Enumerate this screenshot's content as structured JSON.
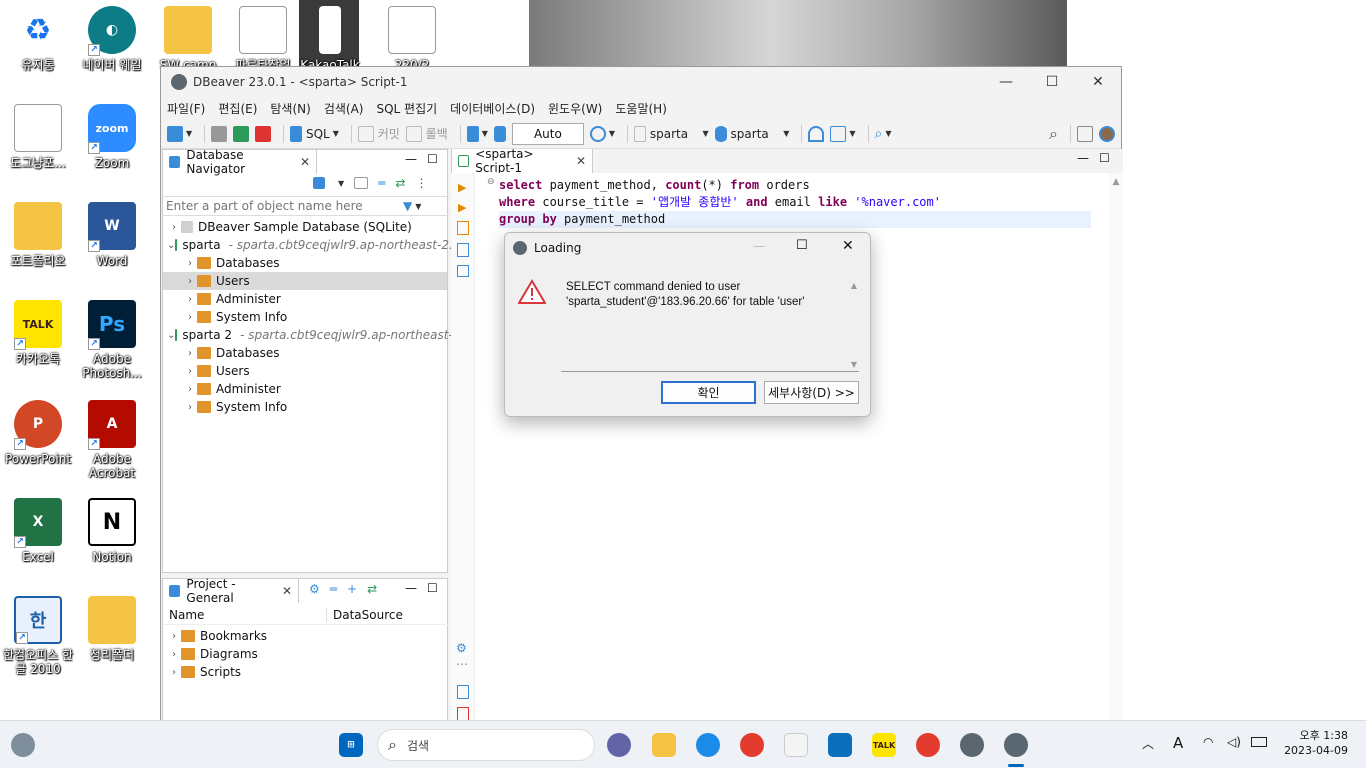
{
  "desktop": {
    "top_labels": [
      "휴지통",
      "네이버 웨일",
      "SW camp",
      "파르타창업",
      "KakaoTalk",
      "220/2"
    ],
    "icons": [
      {
        "label": "유지통",
        "name": "recycle-bin-icon"
      },
      {
        "label": "네이버 웨일",
        "name": "whale-browser-icon"
      },
      {
        "label": "도그냥포...",
        "name": "document-icon"
      },
      {
        "label": "Zoom",
        "name": "zoom-icon"
      },
      {
        "label": "포트폴리오",
        "name": "folder-icon"
      },
      {
        "label": "Word",
        "name": "word-icon"
      },
      {
        "label": "카카오톡",
        "name": "kakaotalk-icon"
      },
      {
        "label": "Adobe Photosh...",
        "name": "photoshop-icon"
      },
      {
        "label": "PowerPoint",
        "name": "powerpoint-icon"
      },
      {
        "label": "Adobe Acrobat",
        "name": "acrobat-icon"
      },
      {
        "label": "Excel",
        "name": "excel-icon"
      },
      {
        "label": "Notion",
        "name": "notion-icon"
      },
      {
        "label": "한컴오피스 한글 2010",
        "name": "hwp-icon"
      },
      {
        "label": "정리폴더",
        "name": "folder-icon"
      }
    ]
  },
  "window": {
    "title": "DBeaver 23.0.1 - <sparta> Script-1",
    "menu": [
      "파일(F)",
      "편집(E)",
      "탐색(N)",
      "검색(A)",
      "SQL 편집기",
      "데이터베이스(D)",
      "윈도우(W)",
      "도움말(H)"
    ],
    "toolbar": {
      "sql": "SQL",
      "commit": "커밋",
      "rollback": "롤백",
      "auto": "Auto",
      "datasource": "sparta",
      "schema": "sparta"
    }
  },
  "navigator": {
    "tab": "Database Navigator",
    "filter_placeholder": "Enter a part of object name here",
    "tree": [
      {
        "label": "DBeaver Sample Database (SQLite)",
        "level": 0,
        "sub": ""
      },
      {
        "label": "sparta",
        "level": 0,
        "sub": "- sparta.cbt9ceqjwlr9.ap-northeast-2.r"
      },
      {
        "label": "Databases",
        "level": 1,
        "sub": ""
      },
      {
        "label": "Users",
        "level": 1,
        "sub": "",
        "selected": true
      },
      {
        "label": "Administer",
        "level": 1,
        "sub": ""
      },
      {
        "label": "System Info",
        "level": 1,
        "sub": ""
      },
      {
        "label": "sparta 2",
        "level": 0,
        "sub": "- sparta.cbt9ceqjwlr9.ap-northeast-2"
      },
      {
        "label": "Databases",
        "level": 1,
        "sub": ""
      },
      {
        "label": "Users",
        "level": 1,
        "sub": ""
      },
      {
        "label": "Administer",
        "level": 1,
        "sub": ""
      },
      {
        "label": "System Info",
        "level": 1,
        "sub": ""
      }
    ]
  },
  "project": {
    "tab": "Project - General",
    "col_name": "Name",
    "col_datasource": "DataSource",
    "items": [
      "Bookmarks",
      "Diagrams",
      "Scripts"
    ]
  },
  "editor": {
    "tab": "<sparta> Script-1",
    "lines": [
      [
        {
          "t": "select",
          "c": "kw"
        },
        {
          "t": " payment_method, ",
          "c": ""
        },
        {
          "t": "count",
          "c": "kw"
        },
        {
          "t": "(*) ",
          "c": ""
        },
        {
          "t": "from",
          "c": "kw"
        },
        {
          "t": " orders",
          "c": ""
        }
      ],
      [
        {
          "t": "where",
          "c": "kw"
        },
        {
          "t": " course_title = ",
          "c": ""
        },
        {
          "t": "'앱개발 종합반'",
          "c": "str"
        },
        {
          "t": " ",
          "c": ""
        },
        {
          "t": "and",
          "c": "kw"
        },
        {
          "t": " email ",
          "c": ""
        },
        {
          "t": "like",
          "c": "kw"
        },
        {
          "t": " ",
          "c": ""
        },
        {
          "t": "'%naver.com'",
          "c": "str"
        }
      ],
      [
        {
          "t": "group by",
          "c": "kw"
        },
        {
          "t": " payment_method",
          "c": ""
        }
      ]
    ]
  },
  "dialog": {
    "title": "Loading",
    "message": "SELECT command denied to user 'sparta_student'@'183.96.20.66' for table 'user'",
    "ok": "확인",
    "details": "세부사항(D) >>"
  },
  "taskbar": {
    "search_placeholder": "검색",
    "time": "오후 1:38",
    "date": "2023-04-09",
    "ime": "A"
  }
}
